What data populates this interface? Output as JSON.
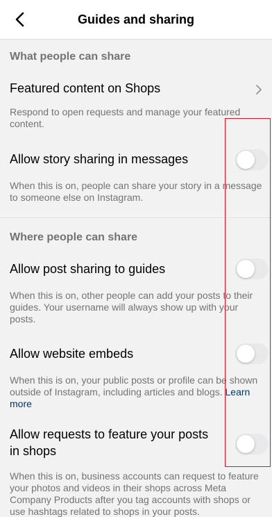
{
  "header": {
    "title": "Guides and sharing",
    "back_icon": "chevron-left-icon"
  },
  "sections": {
    "share_what": "What people can share",
    "share_where": "Where people can share"
  },
  "rows": {
    "featured": {
      "label": "Featured content on Shops",
      "desc": "Respond to open requests and manage your featured content."
    },
    "story": {
      "label": "Allow story sharing in messages",
      "desc": "When this is on, people can share your story in a message to someone else on Instagram.",
      "toggle_on": false
    },
    "guides": {
      "label": "Allow post sharing to guides",
      "desc": "When this is on, other people can add your posts to their guides. Your username will always show up with your posts.",
      "toggle_on": false
    },
    "embeds": {
      "label": "Allow website embeds",
      "desc": "When this is on, your public posts or profile can be shown outside of Instagram, including articles and blogs. ",
      "link": "Learn more",
      "toggle_on": false
    },
    "shops": {
      "label_line1": "Allow requests to feature your posts",
      "label_line2": "in shops",
      "desc": "When this is on, business accounts can request to feature your photos and videos in their shops across Meta Company Products after you tag accounts with shops or use hashtags related to shops in your posts.",
      "toggle_on": false
    }
  },
  "colors": {
    "background": "#f2f2f2",
    "secondary_text": "#737373",
    "link": "#00376b",
    "toggle_off": "#e9e9eb",
    "annotation": "#e0141e"
  }
}
